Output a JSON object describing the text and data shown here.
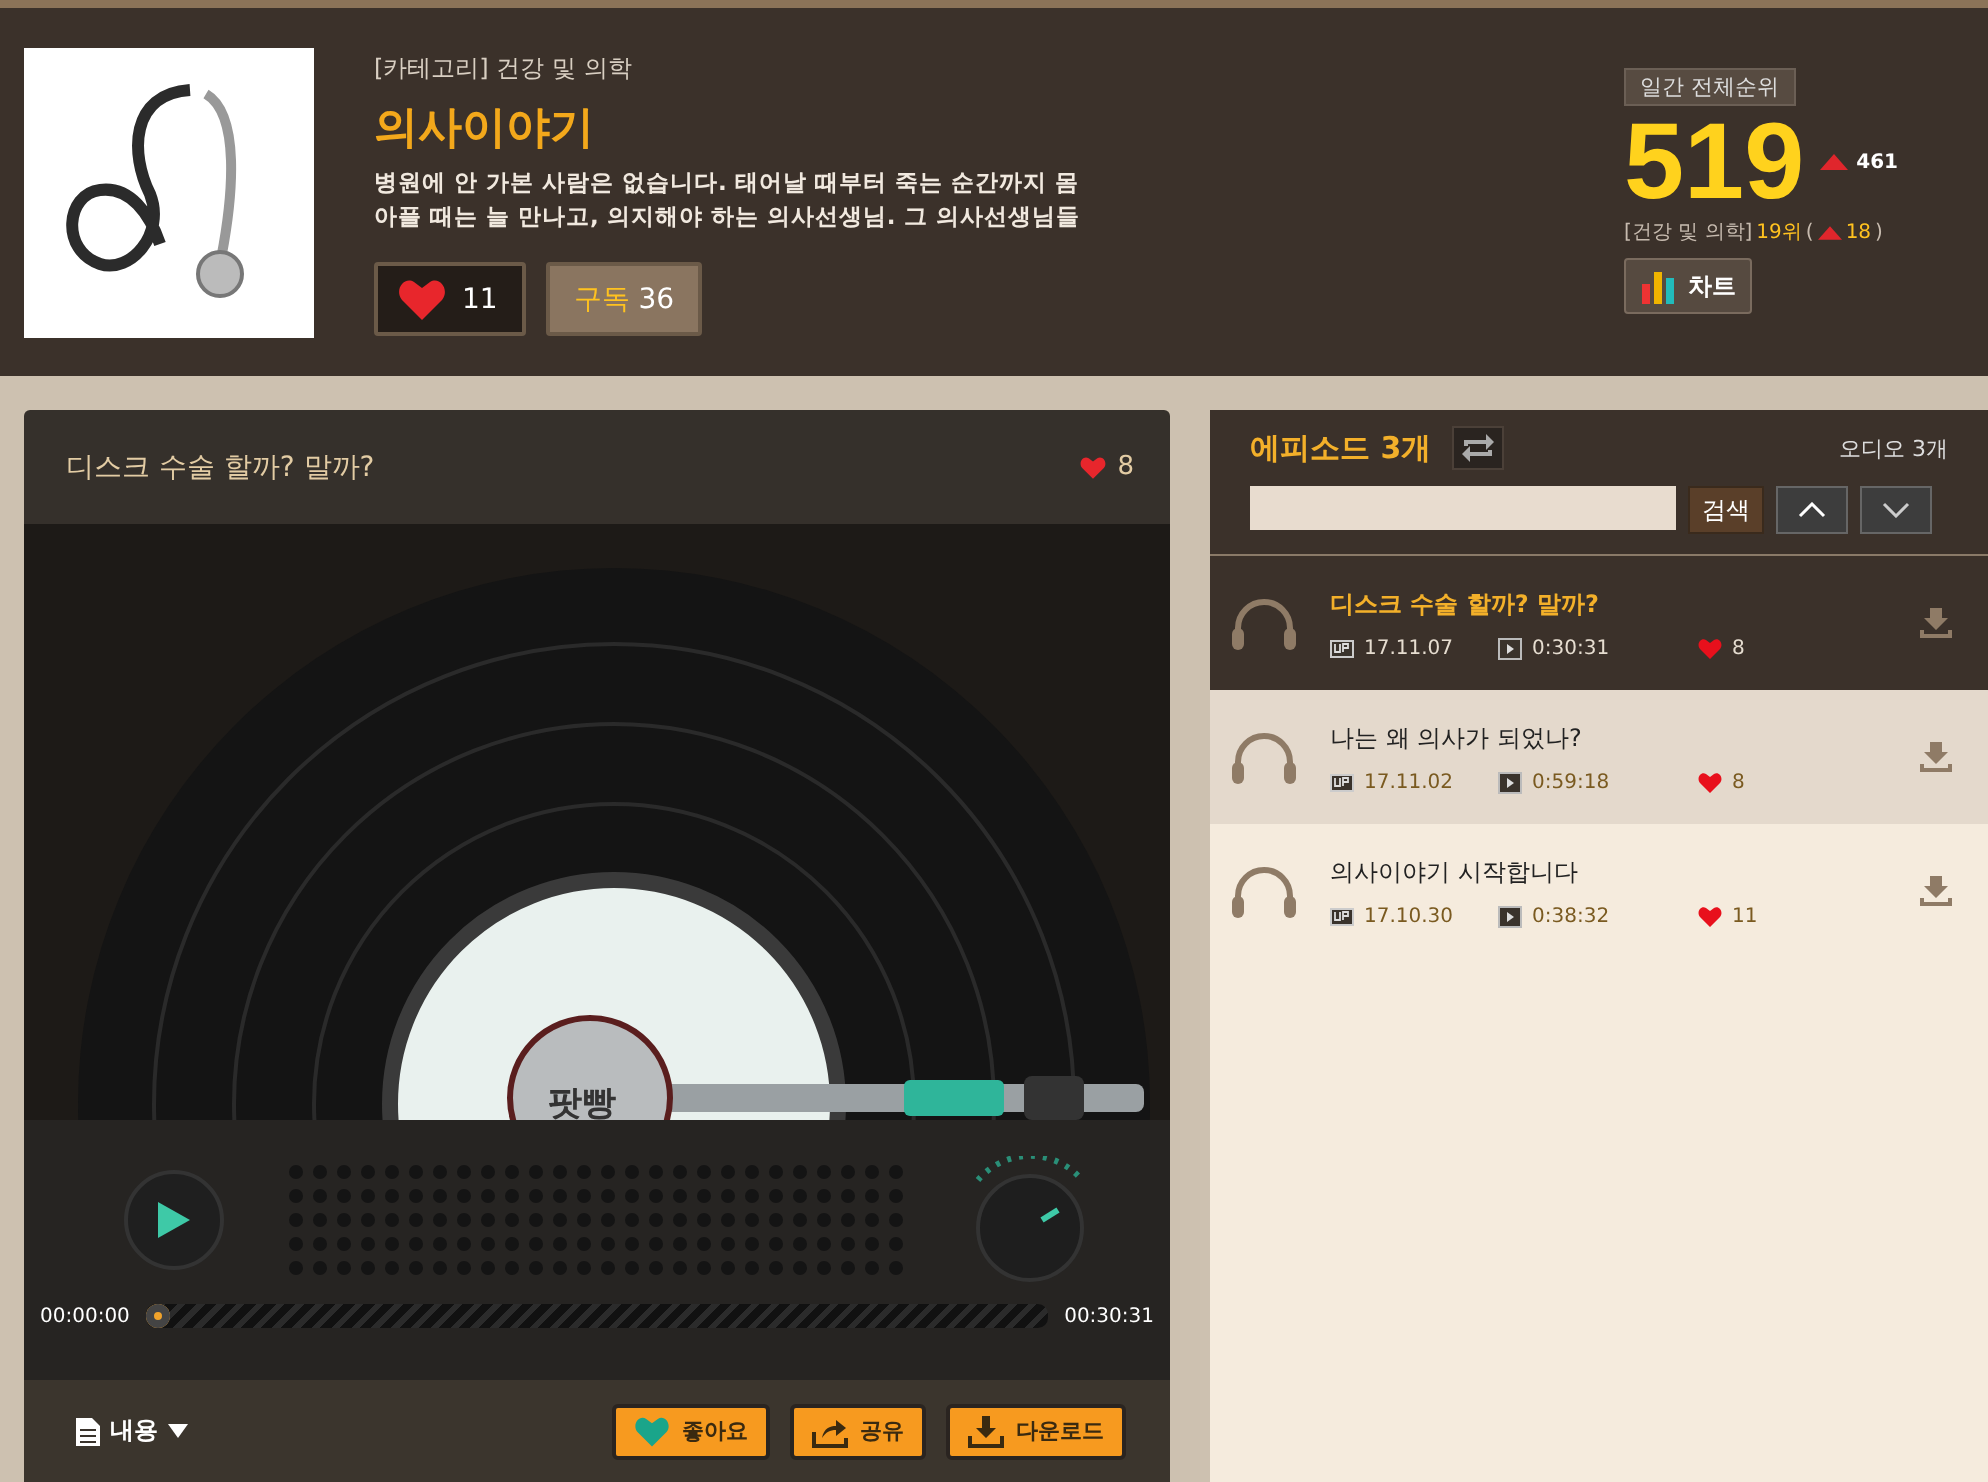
{
  "podcast": {
    "category": "[카테고리] 건강 및 의학",
    "title": "의사이야기",
    "description": "병원에 안 가본 사람은 없습니다. 태어날 때부터 죽는 순간까지 몸\n아플 때는 늘 만나고, 의지해야 하는 의사선생님. 그 의사선생님들",
    "likes": "11",
    "subscribe_label": "구독",
    "subscribers": "36"
  },
  "ranking": {
    "label": "일간 전체순위",
    "rank": "519",
    "change": "461",
    "category_label": "[건강 및 의학]",
    "category_rank": "19위",
    "category_change_open": "(",
    "category_change": "18",
    "category_change_close": ")",
    "chart_button": "차트"
  },
  "player": {
    "title": "디스크 수술 할까? 말까?",
    "likes": "8",
    "brand_label": "팟빵",
    "elapsed": "00:00:00",
    "duration": "00:30:31",
    "level": 0,
    "content_label": "내용",
    "buttons": [
      {
        "kind": "like",
        "label": "좋아요"
      },
      {
        "kind": "share",
        "label": "공유"
      },
      {
        "kind": "download",
        "label": "다운로드"
      }
    ]
  },
  "episodes": {
    "title": "에피소드 3개",
    "audio_count": "오디오 3개",
    "search_button": "검색",
    "items": [
      {
        "title": "디스크 수술 할까? 말까?",
        "date": "17.11.07",
        "duration": "0:30:31",
        "likes": "8",
        "selected": true,
        "highlighted": false
      },
      {
        "title": "나는 왜 의사가 되었나?",
        "date": "17.11.02",
        "duration": "0:59:18",
        "likes": "8",
        "selected": false,
        "highlighted": true
      },
      {
        "title": "의사이야기 시작합니다",
        "date": "17.10.30",
        "duration": "0:38:32",
        "likes": "11",
        "selected": false,
        "highlighted": false
      }
    ]
  }
}
